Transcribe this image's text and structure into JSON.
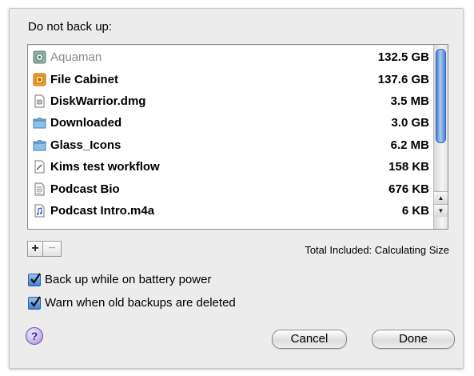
{
  "dialog": {
    "heading": "Do not back up:",
    "add_label": "+",
    "remove_label": "−",
    "total_label": "Total Included: Calculating Size",
    "help_label": "?",
    "cancel_label": "Cancel",
    "done_label": "Done"
  },
  "files": [
    {
      "name": "Aquaman",
      "size": "132.5 GB",
      "icon": "drive-icon",
      "dimmed": true
    },
    {
      "name": "File Cabinet",
      "size": "137.6 GB",
      "icon": "external-drive-icon",
      "dimmed": false
    },
    {
      "name": "DiskWarrior.dmg",
      "size": "3.5 MB",
      "icon": "document-icon",
      "dimmed": false
    },
    {
      "name": "Downloaded",
      "size": "3.0 GB",
      "icon": "folder-icon",
      "dimmed": false
    },
    {
      "name": "Glass_Icons",
      "size": "6.2 MB",
      "icon": "folder-icon",
      "dimmed": false
    },
    {
      "name": "Kims test workflow",
      "size": "158 KB",
      "icon": "workflow-document-icon",
      "dimmed": false
    },
    {
      "name": "Podcast Bio",
      "size": "676 KB",
      "icon": "text-document-icon",
      "dimmed": false
    },
    {
      "name": "Podcast Intro.m4a",
      "size": "6 KB",
      "icon": "audio-file-icon",
      "dimmed": false
    }
  ],
  "options": {
    "battery": {
      "label": "Back up while on battery power",
      "checked": true
    },
    "warn": {
      "label": "Warn when old backups are deleted",
      "checked": true
    }
  },
  "colors": {
    "accent": "#3e7fd3",
    "folder": "#74aede",
    "dim_text": "#8a8a8a"
  }
}
